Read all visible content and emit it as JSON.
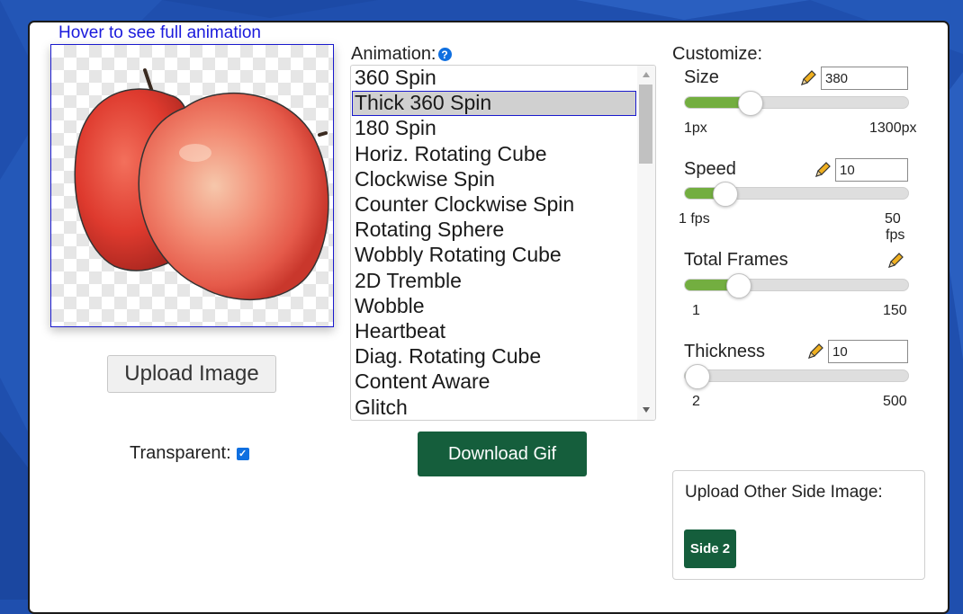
{
  "background": {
    "color": "#1f4fae",
    "shape_color": "#2a5fc0"
  },
  "preview": {
    "hover_text": "Hover to see full animation",
    "image": "apple-image",
    "upload_label": "Upload Image",
    "transparent_label": "Transparent:",
    "transparent_checked": true
  },
  "animation": {
    "label": "Animation:",
    "help_icon": "question-circle-icon",
    "options": [
      "360 Spin",
      "Thick 360 Spin",
      "180 Spin",
      "Horiz. Rotating Cube",
      "Clockwise Spin",
      "Counter Clockwise Spin",
      "Rotating Sphere",
      "Wobbly Rotating Cube",
      "2D Tremble",
      "Wobble",
      "Heartbeat",
      "Diag. Rotating Cube",
      "Content Aware",
      "Glitch"
    ],
    "selected": "Thick 360 Spin",
    "download_label": "Download Gif"
  },
  "customize": {
    "label": "Customize:",
    "pencil_icon": "pencil-icon",
    "size": {
      "label": "Size",
      "value": "380",
      "min_label": "1px",
      "max_label": "1300px",
      "fraction": 0.29
    },
    "speed": {
      "label": "Speed",
      "value": "10",
      "min_label": "1 fps",
      "max_label": "50",
      "max_label_2": "fps",
      "fraction": 0.18
    },
    "frames": {
      "label": "Total Frames",
      "min_label": "1",
      "max_label": "150",
      "fraction": 0.24
    },
    "thickness": {
      "label": "Thickness",
      "value": "10",
      "min_label": "2",
      "max_label": "500",
      "fraction": 0.02
    }
  },
  "side": {
    "label": "Upload Other Side Image:",
    "button_label": "Side 2"
  },
  "colors": {
    "accent_green": "#155e3c",
    "slider_green": "#73ae40",
    "link_blue": "#1a1adc",
    "check_blue": "#0f6fe0"
  }
}
